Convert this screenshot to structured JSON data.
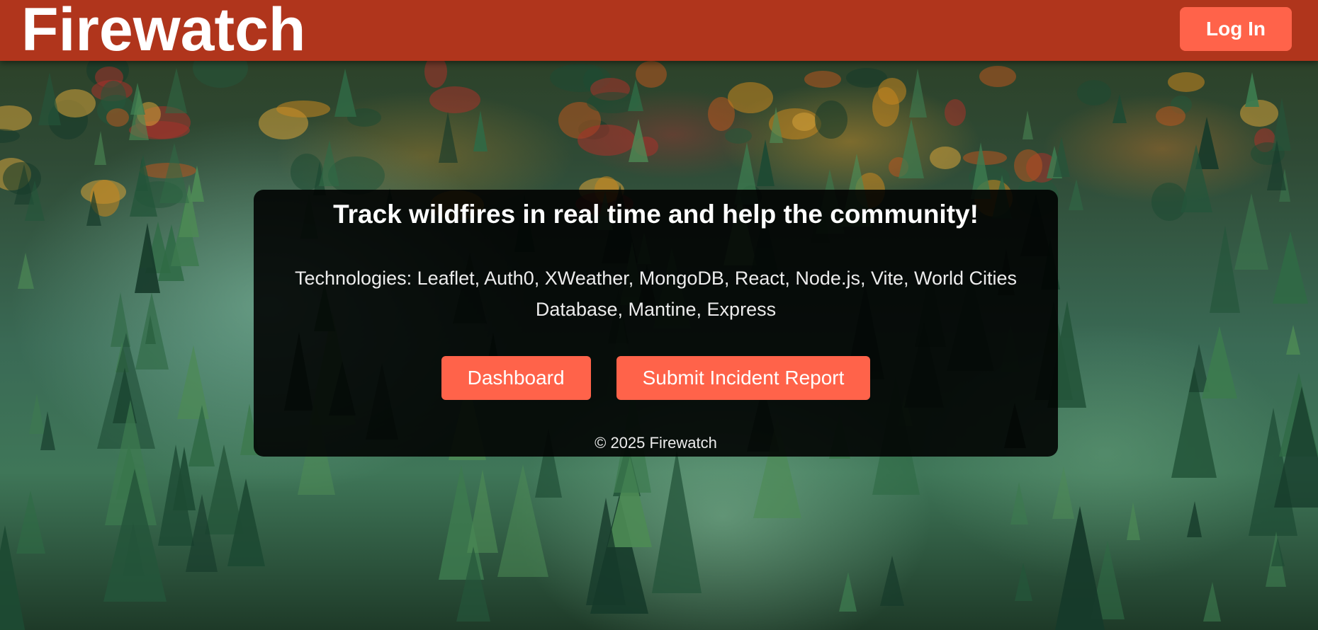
{
  "header": {
    "logo": "Firewatch",
    "login_label": "Log In"
  },
  "hero": {
    "headline": "Track wildfires in real time and help the community!",
    "technologies": "Technologies: Leaflet, Auth0, XWeather, MongoDB, React, Node.js, Vite, World Cities Database, Mantine, Express",
    "dashboard_label": "Dashboard",
    "report_label": "Submit Incident Report",
    "footer": "© 2025 Firewatch"
  },
  "colors": {
    "header_bg": "#b0351c",
    "accent": "#ff634a",
    "panel_bg": "rgba(0,0,0,0.88)"
  },
  "background": "forest-photo"
}
